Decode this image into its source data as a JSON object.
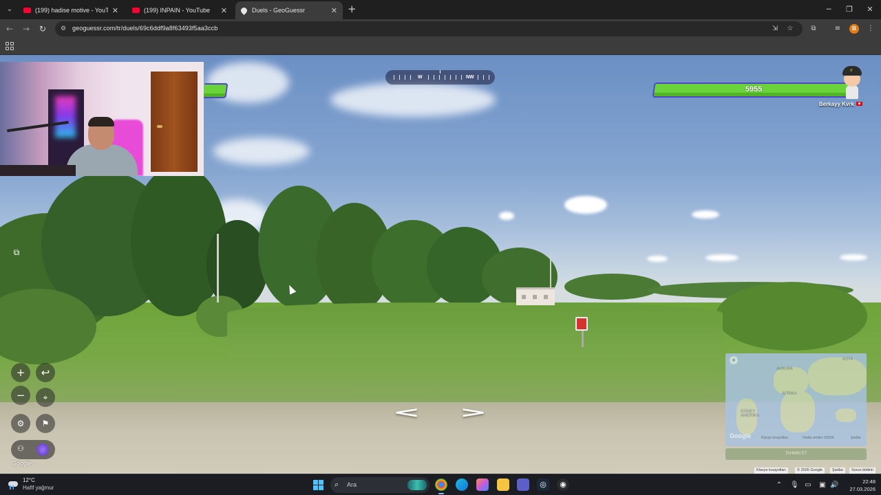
{
  "browser": {
    "tabs": [
      {
        "title": "(199) hadise motive - YouTube",
        "icon": "youtube-icon",
        "active": false
      },
      {
        "title": "(199) INPAIN - YouTube",
        "icon": "youtube-icon",
        "active": false
      },
      {
        "title": "Duels - GeoGuessr",
        "icon": "location-pin-icon",
        "active": true
      }
    ],
    "url": "geoguessr.com/tr/duels/69c6ddf9a8f63493f5aa3ccb",
    "profile_initial": "B"
  },
  "game": {
    "compass": {
      "w_label": "W",
      "nw_label": "NW"
    },
    "opponent_health_fraction": 0.12,
    "player": {
      "health": "5955",
      "health_fraction": 1.0,
      "name": "Berkayy Kvrk"
    },
    "google_logo": "Google",
    "minimap": {
      "labels": {
        "asia": "ASYA",
        "europe": "AVRUPA",
        "africa": "AFRİKA",
        "south_america": "GÜNEY AMERİKA",
        "google": "Google",
        "shortcuts": "Klavye kısayolları",
        "map_data": "Harita verileri ©2026",
        "terms": "Şartlar"
      },
      "button_label": "TAHMİN ET"
    },
    "attribution": {
      "shortcuts": "Klavye kısayolları",
      "copyright": "© 2026 Google",
      "terms": "Şartlar",
      "report": "Sorun bildirin"
    }
  },
  "taskbar": {
    "weather": {
      "temp": "12°C",
      "desc": "Hafif yağmur"
    },
    "search_placeholder": "Ara",
    "time": "22:48",
    "date": "27.03.2026"
  },
  "colors": {
    "health_green": "#6ad33c",
    "health_border": "#5146c7",
    "scene_sky": "#86a6d1"
  }
}
